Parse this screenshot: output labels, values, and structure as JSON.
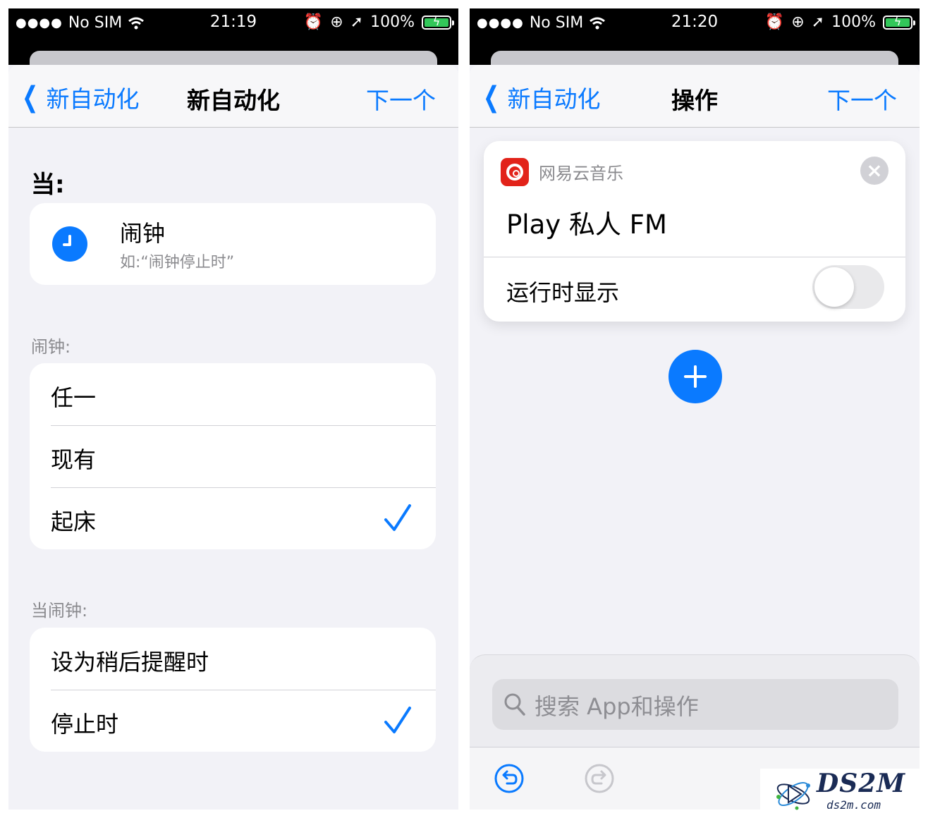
{
  "left": {
    "status": {
      "carrier": "No SIM",
      "time": "21:19",
      "battery": "100%"
    },
    "nav": {
      "back": "新自动化",
      "title": "新自动化",
      "next": "下一个"
    },
    "when_heading": "当:",
    "trigger": {
      "title": "闹钟",
      "subtitle": "如:“闹钟停止时”"
    },
    "alarm_section": {
      "label": "闹钟:",
      "options": [
        {
          "label": "任一",
          "checked": false
        },
        {
          "label": "现有",
          "checked": false
        },
        {
          "label": "起床",
          "checked": true
        }
      ]
    },
    "when_alarm_section": {
      "label": "当闹钟:",
      "options": [
        {
          "label": "设为稍后提醒时",
          "checked": false
        },
        {
          "label": "停止时",
          "checked": true
        }
      ]
    }
  },
  "right": {
    "status": {
      "carrier": "No SIM",
      "time": "21:20",
      "battery": "100%"
    },
    "nav": {
      "back": "新自动化",
      "title": "操作",
      "next": "下一个"
    },
    "action": {
      "app_name": "网易云音乐",
      "title": "Play 私人 FM",
      "show_when_run_label": "运行时显示",
      "show_when_run": false
    },
    "search": {
      "placeholder": "搜索 App和操作"
    }
  },
  "watermark": {
    "brand": "DS2M",
    "domain": "ds2m.com"
  },
  "colors": {
    "accent": "#0a7aff",
    "app_icon": "#e2231a",
    "background": "#f2f2f7"
  }
}
